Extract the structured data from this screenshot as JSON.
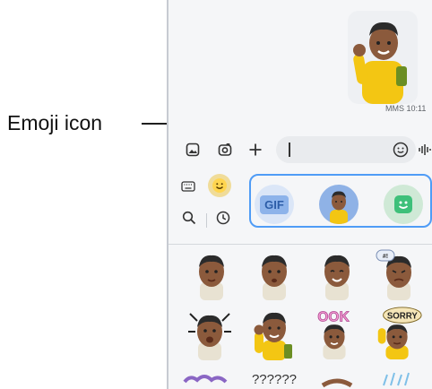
{
  "callout": {
    "label": "Emoji icon"
  },
  "chat": {
    "timestamp": "MMS 10:11"
  },
  "composer": {
    "icons": [
      "gallery-icon",
      "camera-icon",
      "plus-icon",
      "emoji-icon",
      "voice-icon"
    ],
    "input_value": ""
  },
  "panel": {
    "tabs": [
      "keyboard-icon",
      "emoji-smiley-icon",
      "search-icon",
      "recent-icon"
    ],
    "categories": [
      {
        "name": "gif",
        "label": "GIF"
      },
      {
        "name": "ar-emoji",
        "label": ""
      },
      {
        "name": "sticker",
        "label": ""
      }
    ],
    "sticker_texts": [
      "SORRY",
      "OOK",
      "???"
    ]
  },
  "colors": {
    "accent": "#4f9cf6",
    "gif_bg": "#dbe6f7",
    "sticker_green": "#3ec07a",
    "emoji_yellow": "#ffd54f"
  }
}
